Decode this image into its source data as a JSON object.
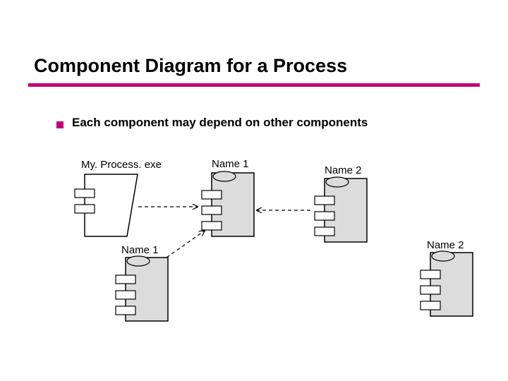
{
  "title": "Component Diagram for a Process",
  "bullet": "Each component may depend on other components",
  "labels": {
    "myprocess": "My. Process. exe",
    "name1_top": "Name 1",
    "name2_top": "Name 2",
    "name1_bottom": "Name 1",
    "name2_bottom": "Name 2"
  },
  "colors": {
    "accent": "#c30078",
    "fill": "#dcdcdc",
    "stroke": "#000000"
  }
}
